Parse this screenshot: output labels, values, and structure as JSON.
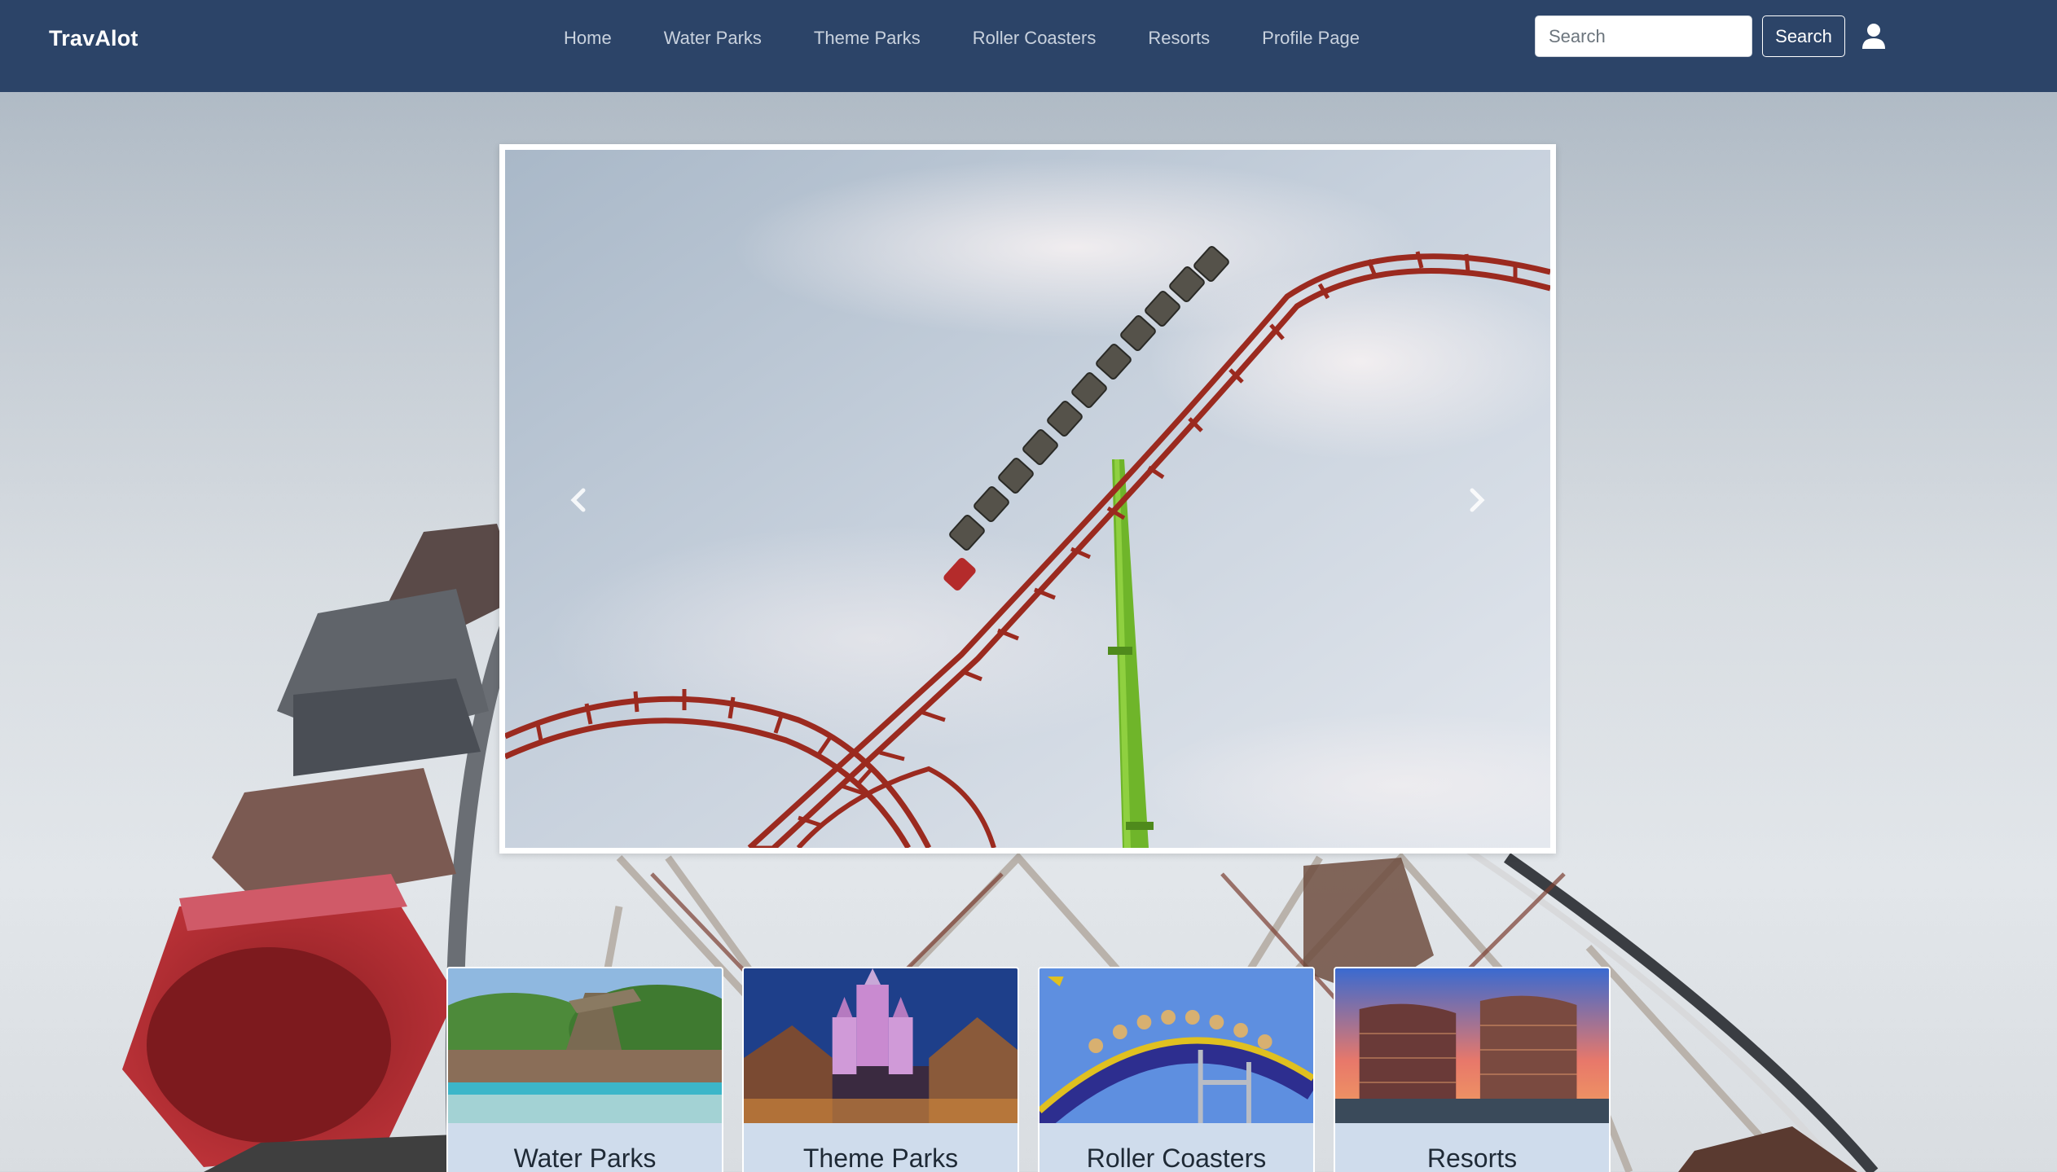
{
  "brand": {
    "name": "TravAlot"
  },
  "nav": {
    "links": [
      {
        "label": "Home"
      },
      {
        "label": "Water Parks"
      },
      {
        "label": "Theme Parks"
      },
      {
        "label": "Roller Coasters"
      },
      {
        "label": "Resorts"
      },
      {
        "label": "Profile Page"
      }
    ]
  },
  "search": {
    "placeholder": "Search",
    "value": "",
    "button_label": "Search"
  },
  "icons": {
    "user": "user-icon",
    "carousel_prev": "chevron-left-icon",
    "carousel_next": "chevron-right-icon"
  },
  "colors": {
    "navbar": "#2c4468",
    "card_background": "#cfdcec",
    "coaster_track": "#9b2a1f",
    "coaster_support": "#6fb52a"
  },
  "cards": [
    {
      "title": "Water Parks"
    },
    {
      "title": "Theme Parks"
    },
    {
      "title": "Roller Coasters"
    },
    {
      "title": "Resorts"
    }
  ]
}
